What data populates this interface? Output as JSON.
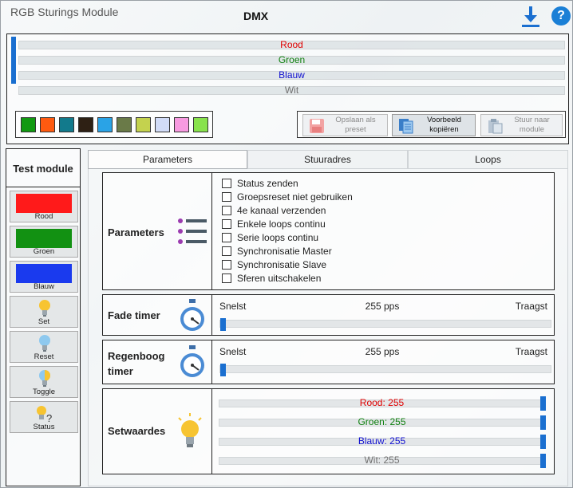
{
  "app_title": "RGB Sturings Module",
  "page_title": "DMX",
  "toolbar": {
    "download_icon": "download-icon",
    "help_icon": "help-icon",
    "help_glyph": "?"
  },
  "channels": [
    {
      "label": "Rood",
      "color": "#e00000"
    },
    {
      "label": "Groen",
      "color": "#108010"
    },
    {
      "label": "Blauw",
      "color": "#1010d0"
    },
    {
      "label": "Wit",
      "color": "#707070"
    }
  ],
  "swatches": [
    "#119911",
    "#ff5a10",
    "#127a8c",
    "#2e2014",
    "#2aa3e6",
    "#6a7a48",
    "#c4d24e",
    "#d2dcf8",
    "#f79ae0",
    "#88e24c"
  ],
  "actions": {
    "save_preset": {
      "label": "Opslaan als preset"
    },
    "copy_example": {
      "label": "Voorbeeld kopiëren"
    },
    "send_module": {
      "label": "Stuur naar module"
    }
  },
  "test_module": {
    "title": "Test module",
    "buttons": [
      {
        "label": "Rood",
        "color": "#ff1a1a"
      },
      {
        "label": "Groen",
        "color": "#129112"
      },
      {
        "label": "Blauw",
        "color": "#1a3aee"
      },
      {
        "label": "Set"
      },
      {
        "label": "Reset"
      },
      {
        "label": "Toggle"
      },
      {
        "label": "Status"
      }
    ]
  },
  "tabs": [
    "Parameters",
    "Stuuradres",
    "Loops"
  ],
  "parameters": {
    "title": "Parameters",
    "options": [
      "Status zenden",
      "Groepsreset niet gebruiken",
      "4e kanaal verzenden",
      "Enkele loops continu",
      "Serie loops continu",
      "Synchronisatie Master",
      "Synchronisatie Slave",
      "Sferen uitschakelen"
    ]
  },
  "fade_timer": {
    "title": "Fade timer",
    "min_label": "Snelst",
    "max_label": "Traagst",
    "value": "255 pps",
    "level": 0
  },
  "rainbow_timer": {
    "title": "Regenboog timer",
    "min_label": "Snelst",
    "max_label": "Traagst",
    "value": "255 pps",
    "level": 0
  },
  "setwaardes": {
    "title": "Setwaardes",
    "rows": [
      {
        "label": "Rood: 255",
        "color": "#e00000",
        "value": 255
      },
      {
        "label": "Groen: 255",
        "color": "#108010",
        "value": 255
      },
      {
        "label": "Blauw: 255",
        "color": "#1010d0",
        "value": 255
      },
      {
        "label": "Wit: 255",
        "color": "#707070",
        "value": 255
      }
    ]
  }
}
